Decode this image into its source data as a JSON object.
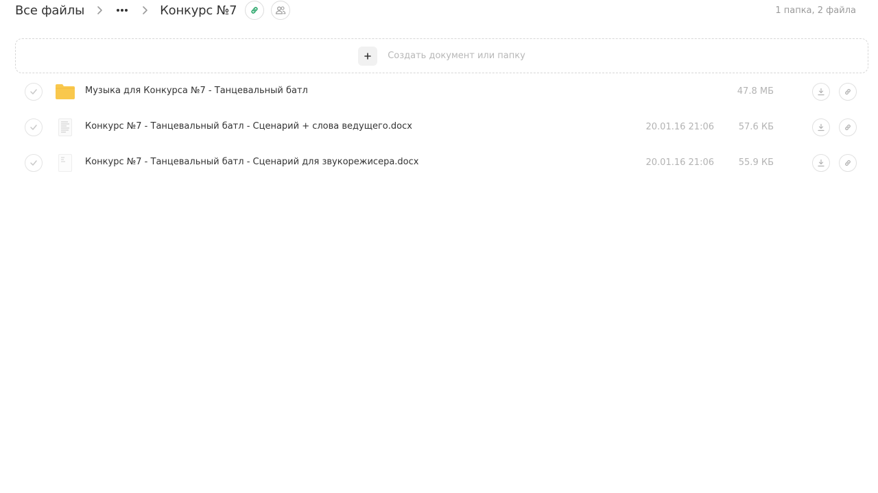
{
  "breadcrumb": {
    "root": "Все файлы",
    "more": "•••",
    "current": "Конкурс №7"
  },
  "header": {
    "summary": "1 папка, 2 файла"
  },
  "create": {
    "plus": "+",
    "label": "Создать документ или папку"
  },
  "colors": {
    "accent_link": "#2aa66a",
    "folder": "#f9c84d",
    "muted_text": "#b3b3b3"
  },
  "files": [
    {
      "icon": "folder-icon",
      "name": "Музыка для Конкурса №7 - Танцевальный батл",
      "date": "",
      "size": "47.8 МБ"
    },
    {
      "icon": "document-icon",
      "name": "Конкурс №7 - Танцевальный батл - Сценарий + слова ведущего.docx",
      "date": "20.01.16 21:06",
      "size": "57.6 КБ"
    },
    {
      "icon": "document-icon",
      "name": "Конкурс №7 - Танцевальный батл - Сценарий для звукорежисера.docx",
      "date": "20.01.16 21:06",
      "size": "55.9 КБ"
    }
  ]
}
